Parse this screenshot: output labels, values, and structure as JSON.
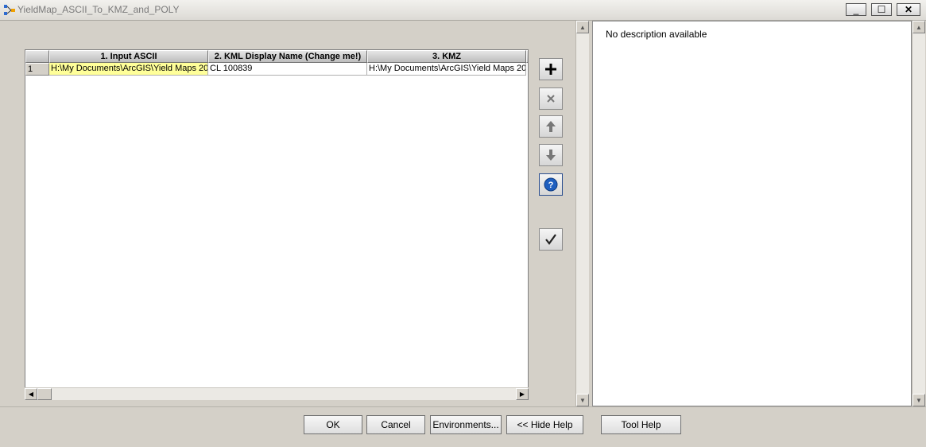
{
  "window": {
    "title": "YieldMap_ASCII_To_KMZ_and_POLY",
    "controls": {
      "minimize": "_",
      "maximize": "☐",
      "close": "✕"
    }
  },
  "grid": {
    "columns": [
      "1. Input ASCII",
      "2. KML Display Name (Change me!)",
      "3. KMZ"
    ],
    "rows": [
      {
        "number": "1",
        "cells": [
          "H:\\My Documents\\ArcGIS\\Yield Maps 20",
          "CL 100839",
          "H:\\My Documents\\ArcGIS\\Yield Maps 20"
        ]
      }
    ],
    "selected_cell_color": "#ffff99"
  },
  "side_buttons": {
    "add_icon": "plus-icon",
    "remove_icon": "close-icon",
    "move_up_icon": "arrow-up-icon",
    "move_down_icon": "arrow-down-icon",
    "help_icon": "help-icon",
    "check_icon": "checkmark-icon"
  },
  "help": {
    "text": "No description available"
  },
  "buttons": {
    "ok": "OK",
    "cancel": "Cancel",
    "environments": "Environments...",
    "hide_help": "<< Hide Help",
    "tool_help": "Tool Help"
  },
  "colors": {
    "accent_help": "#1f5fbf",
    "face": "#d4d0c8"
  }
}
